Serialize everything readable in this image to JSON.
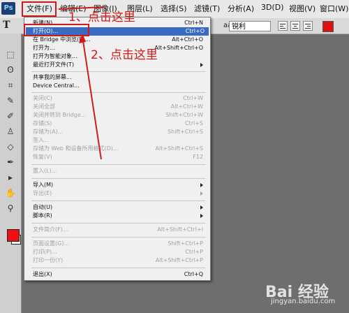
{
  "menubar": {
    "logo": "Ps",
    "items": [
      "文件(F)",
      "编辑(E)",
      "图像(I)",
      "图层(L)",
      "选择(S)",
      "滤镜(T)",
      "分析(A)",
      "3D(D)",
      "视图(V)",
      "窗口(W)"
    ]
  },
  "options": {
    "tool_glyph": "T",
    "font_size_icon": "aa",
    "antialias": "锐利",
    "text_color": "#e01010"
  },
  "toolbox": {
    "fg_color": "#e01010",
    "bg_color": "#ffffff"
  },
  "file_menu": {
    "items": [
      {
        "label": "新建(N)...",
        "shortcut": "Ctrl+N",
        "disabled": false
      },
      {
        "label": "打开(O)...",
        "shortcut": "Ctrl+O",
        "highlighted": true
      },
      {
        "label": "在 Bridge 中浏览(B)...",
        "shortcut": "Alt+Ctrl+O"
      },
      {
        "label": "打开为...",
        "shortcut": "Alt+Shift+Ctrl+O"
      },
      {
        "label": "打开为智能对象..."
      },
      {
        "label": "最近打开文件(T)",
        "submenu": true
      },
      {
        "label": "共享我的屏幕..."
      },
      {
        "label": "Device Central..."
      },
      {
        "label": "关闭(C)",
        "shortcut": "Ctrl+W",
        "disabled": true
      },
      {
        "label": "关闭全部",
        "shortcut": "Alt+Ctrl+W",
        "disabled": true
      },
      {
        "label": "关闭并转到 Bridge...",
        "shortcut": "Shift+Ctrl+W",
        "disabled": true
      },
      {
        "label": "存储(S)",
        "shortcut": "Ctrl+S",
        "disabled": true
      },
      {
        "label": "存储为(A)...",
        "shortcut": "Shift+Ctrl+S",
        "disabled": true
      },
      {
        "label": "签入...",
        "disabled": true
      },
      {
        "label": "存储为 Web 和设备所用格式(D)...",
        "shortcut": "Alt+Shift+Ctrl+S",
        "disabled": true
      },
      {
        "label": "恢复(V)",
        "shortcut": "F12",
        "disabled": true
      },
      {
        "label": "置入(L)...",
        "disabled": true
      },
      {
        "label": "导入(M)",
        "submenu": true
      },
      {
        "label": "导出(E)",
        "submenu": true,
        "disabled": true
      },
      {
        "label": "自动(U)",
        "submenu": true
      },
      {
        "label": "脚本(R)",
        "submenu": true
      },
      {
        "label": "文件简介(F)...",
        "shortcut": "Alt+Shift+Ctrl+I",
        "disabled": true
      },
      {
        "label": "页面设置(G)...",
        "shortcut": "Shift+Ctrl+P",
        "disabled": true
      },
      {
        "label": "打印(P)...",
        "shortcut": "Ctrl+P",
        "disabled": true
      },
      {
        "label": "打印一份(Y)",
        "shortcut": "Alt+Shift+Ctrl+P",
        "disabled": true
      },
      {
        "label": "退出(X)",
        "shortcut": "Ctrl+Q"
      }
    ]
  },
  "annotations": {
    "step1": "1、点击这里",
    "step2": "2、点击这里"
  },
  "watermark": {
    "logo": "Bai 经验",
    "url": "jingyan.baidu.com"
  }
}
